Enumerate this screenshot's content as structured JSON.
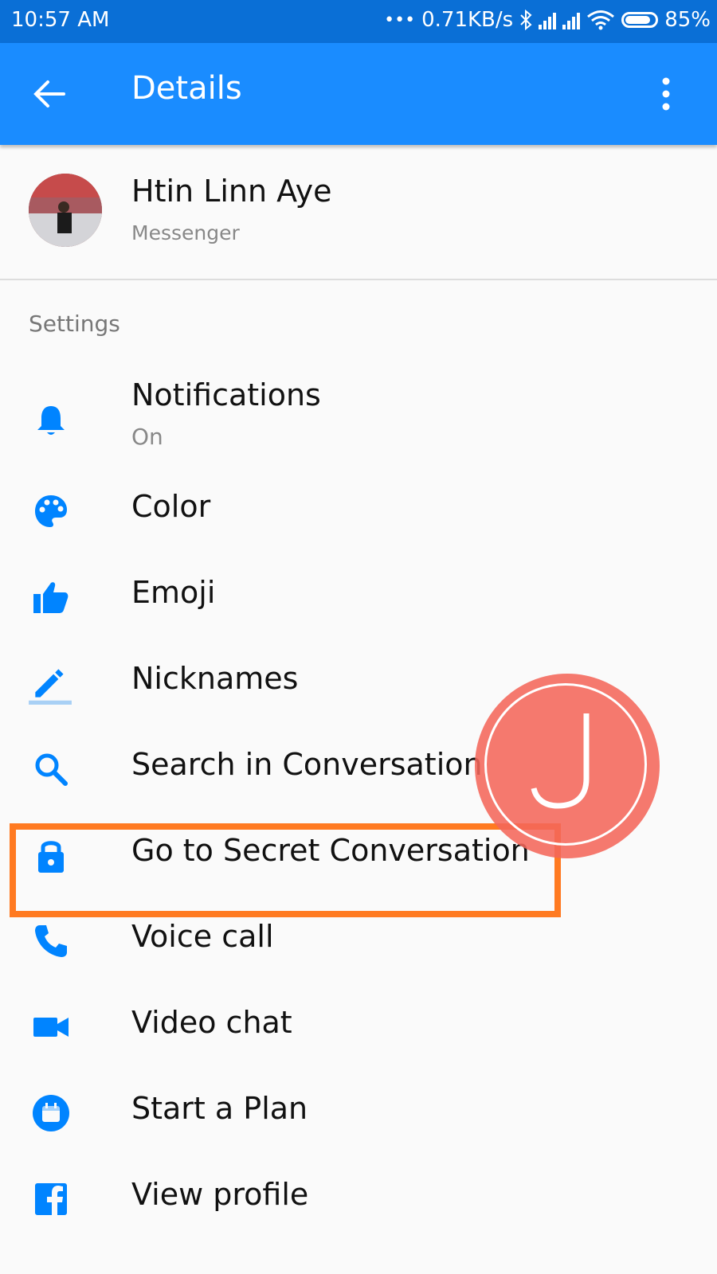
{
  "status_bar": {
    "time": "10:57 AM",
    "network_speed": "0.71KB/s",
    "battery": "85%",
    "dots": "•••"
  },
  "app_bar": {
    "title": "Details",
    "back_icon": "arrow-back-icon",
    "more_icon": "more-vert-icon"
  },
  "profile": {
    "name": "Htin Linn Aye",
    "subtitle": "Messenger"
  },
  "settings": {
    "section_label": "Settings",
    "items": [
      {
        "label": "Notifications",
        "sublabel": "On",
        "icon": "bell-icon"
      },
      {
        "label": "Color",
        "icon": "palette-icon"
      },
      {
        "label": "Emoji",
        "icon": "thumbs-up-icon"
      },
      {
        "label": "Nicknames",
        "icon": "pencil-icon"
      },
      {
        "label": "Search in Conversation",
        "icon": "search-icon"
      },
      {
        "label": "Go to Secret Conversation",
        "icon": "lock-icon"
      },
      {
        "label": "Voice call",
        "icon": "phone-icon"
      },
      {
        "label": "Video chat",
        "icon": "video-camera-icon"
      },
      {
        "label": "Start a Plan",
        "icon": "calendar-icon"
      },
      {
        "label": "View profile",
        "icon": "facebook-icon"
      }
    ]
  },
  "watermark": {
    "letter": "J"
  },
  "colors": {
    "status_bar": "#0a6fd6",
    "app_bar": "#1a8cff",
    "icon_blue": "#0084ff",
    "highlight": "#ff7a21",
    "watermark": "#f4665a"
  }
}
